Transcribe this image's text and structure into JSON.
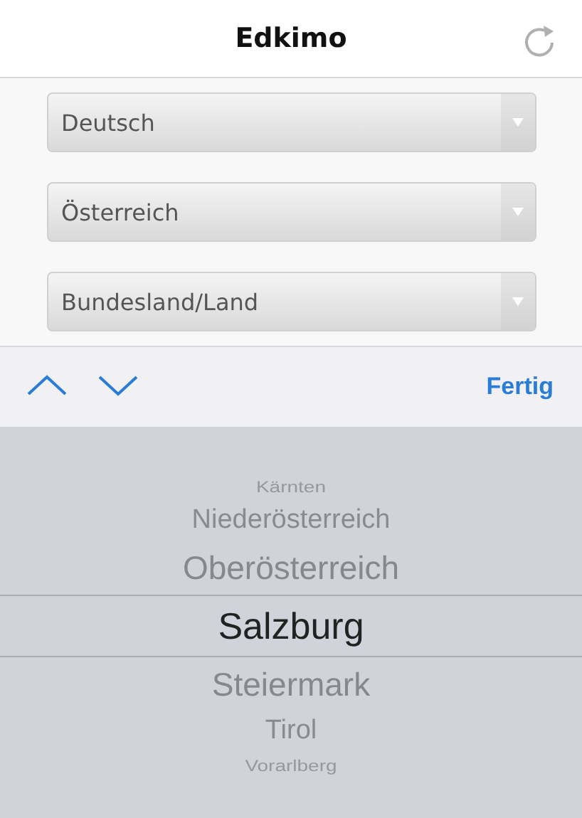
{
  "header": {
    "title": "Edkimo"
  },
  "selects": [
    {
      "value": "Deutsch"
    },
    {
      "value": "Österreich"
    },
    {
      "value": "Bundesland/Land"
    }
  ],
  "toolbar": {
    "done": "Fertig"
  },
  "picker": {
    "items": [
      {
        "label": "Kärnten",
        "selected": false
      },
      {
        "label": "Niederösterreich",
        "selected": false
      },
      {
        "label": "Oberösterreich",
        "selected": false
      },
      {
        "label": "Salzburg",
        "selected": true
      },
      {
        "label": "Steiermark",
        "selected": false
      },
      {
        "label": "Tirol",
        "selected": false
      },
      {
        "label": "Vorarlberg",
        "selected": false
      }
    ]
  }
}
